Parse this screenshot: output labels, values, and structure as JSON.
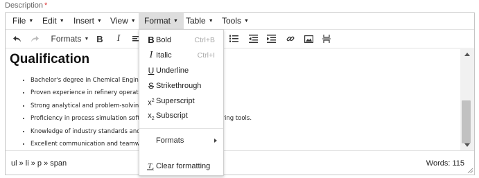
{
  "field": {
    "label": "Description",
    "required_mark": "*"
  },
  "menubar": [
    "File",
    "Edit",
    "Insert",
    "View",
    "Format",
    "Table",
    "Tools"
  ],
  "toolbar": {
    "formats_label": "Formats",
    "bold_glyph": "B",
    "italic_glyph": "I"
  },
  "content": {
    "heading": "Qualification",
    "items": [
      "Bachelor's degree in Chemical Engine",
      "Proven experience in refinery operatio",
      "Strong analytical and problem-solving",
      "Proficiency in process simulation softw",
      "Knowledge of industry standards and",
      "Excellent communication and teamwo"
    ],
    "item4_trail": "eering tools."
  },
  "statusbar": {
    "path": "ul » li » p » span",
    "words": "Words: 115"
  },
  "format_menu": {
    "bold": {
      "label": "Bold",
      "shortcut": "Ctrl+B"
    },
    "italic": {
      "label": "Italic",
      "shortcut": "Ctrl+I"
    },
    "underline": {
      "label": "Underline"
    },
    "strikethrough": {
      "label": "Strikethrough"
    },
    "superscript": {
      "label": "Superscript"
    },
    "subscript": {
      "label": "Subscript"
    },
    "formats": {
      "label": "Formats"
    },
    "clear": {
      "label": "Clear formatting"
    }
  }
}
